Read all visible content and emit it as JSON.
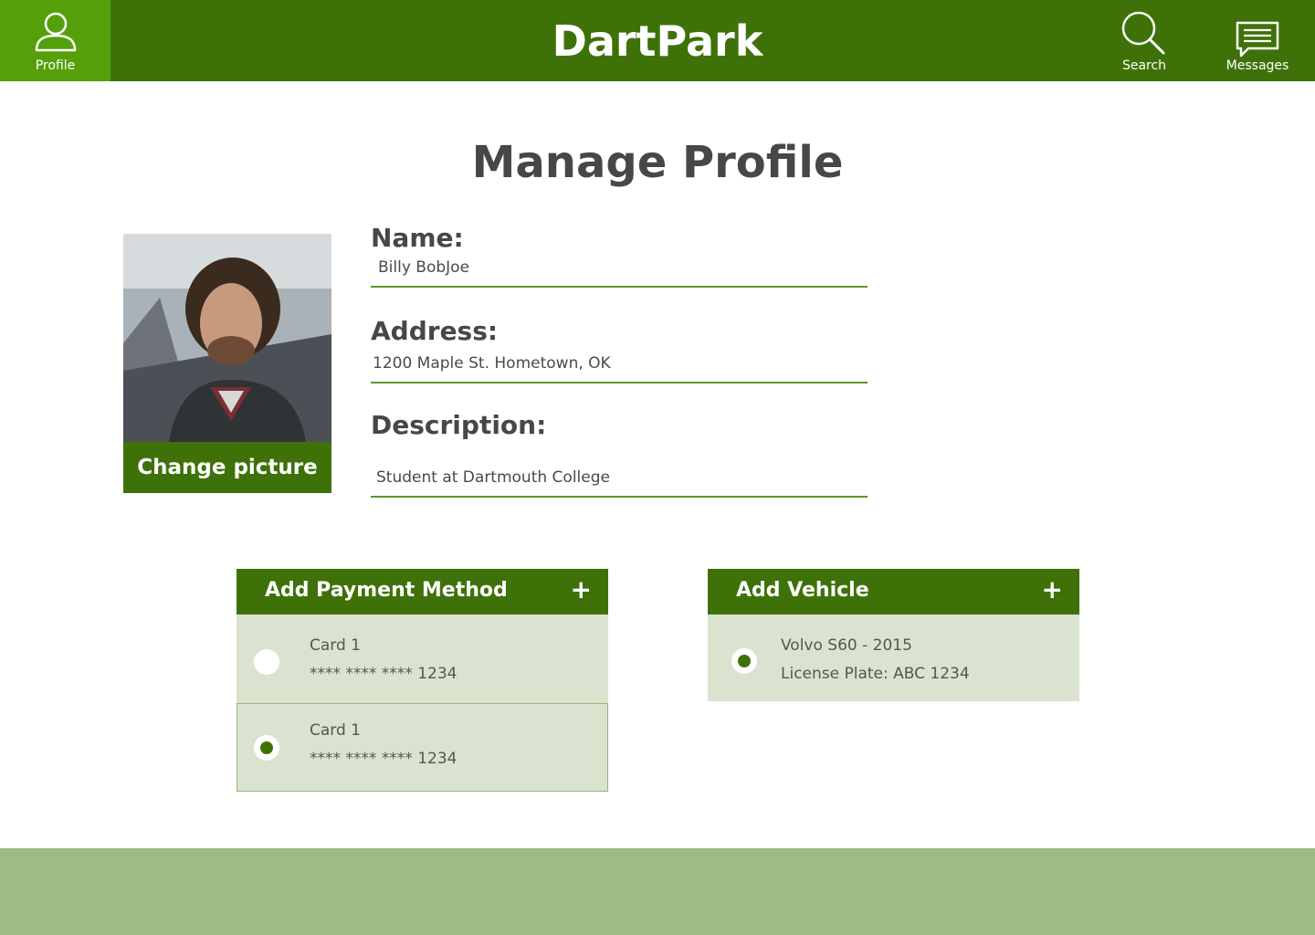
{
  "colors": {
    "primary": "#3e7209",
    "active_nav": "#55a00a",
    "item_bg": "#dae3cf",
    "footer": "#a0ba83",
    "underline": "#5f962c"
  },
  "header": {
    "title": "DartPark",
    "nav": {
      "profile": {
        "label": "Profile",
        "icon": "user-icon"
      },
      "search": {
        "label": "Search",
        "icon": "search-icon"
      },
      "messages": {
        "label": "Messages",
        "icon": "message-icon"
      }
    }
  },
  "page": {
    "title": "Manage Profile"
  },
  "profile": {
    "change_picture_label": "Change picture",
    "fields": {
      "name": {
        "label": "Name:",
        "value": "Billy BobJoe"
      },
      "address": {
        "label": "Address:",
        "value": "1200 Maple St. Hometown, OK"
      },
      "description": {
        "label": "Description:",
        "value": "Student at Dartmouth College"
      }
    }
  },
  "payment": {
    "header": "Add Payment Method",
    "add_symbol": "+",
    "items": [
      {
        "name": "Card 1",
        "number": "**** **** **** 1234",
        "selected": false
      },
      {
        "name": "Card 1",
        "number": "**** **** **** 1234",
        "selected": true
      }
    ]
  },
  "vehicle": {
    "header": "Add Vehicle",
    "add_symbol": "+",
    "items": [
      {
        "name": "Volvo S60 - 2015",
        "plate": "License Plate: ABC 1234",
        "selected": true
      }
    ]
  }
}
